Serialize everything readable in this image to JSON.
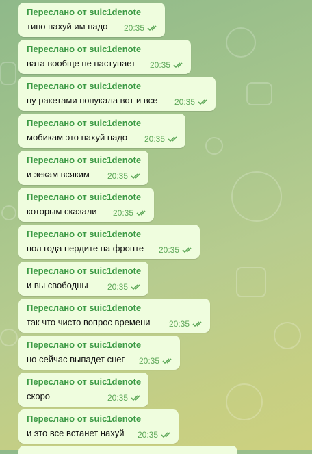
{
  "messages": [
    {
      "forwarded": "Переслано от suic1denote",
      "text": "типо нахуй им надо",
      "time": "20:35"
    },
    {
      "forwarded": "Переслано от suic1denote",
      "text": "вата вообще не наступает",
      "time": "20:35"
    },
    {
      "forwarded": "Переслано от suic1denote",
      "text": "ну ракетами попукала вот и все",
      "time": "20:35"
    },
    {
      "forwarded": "Переслано от suic1denote",
      "text": "мобикам это нахуй надо",
      "time": "20:35"
    },
    {
      "forwarded": "Переслано от suic1denote",
      "text": "и зекам всяким",
      "time": "20:35"
    },
    {
      "forwarded": "Переслано от suic1denote",
      "text": "которым сказали",
      "time": "20:35"
    },
    {
      "forwarded": "Переслано от suic1denote",
      "text": "пол года пердите на фронте",
      "time": "20:35"
    },
    {
      "forwarded": "Переслано от suic1denote",
      "text": "и вы свободны",
      "time": "20:35"
    },
    {
      "forwarded": "Переслано от suic1denote",
      "text": "так что чисто вопрос времени",
      "time": "20:35"
    },
    {
      "forwarded": "Переслано от suic1denote",
      "text": "но сейчас выпадет снег",
      "time": "20:35"
    },
    {
      "forwarded": "Переслано от suic1denote",
      "text": "скоро",
      "time": "20:35"
    },
    {
      "forwarded": "Переслано от suic1denote",
      "text": "и это все встанет нахуй",
      "time": "20:35"
    }
  ],
  "icons": {
    "read_status": "double-check-icon"
  },
  "colors": {
    "bubble": "#effdde",
    "forward_label": "#3c9a45",
    "time": "#5fa85a"
  }
}
